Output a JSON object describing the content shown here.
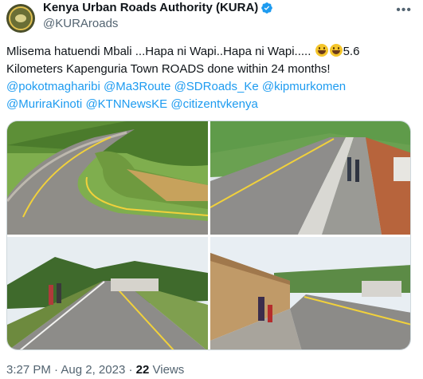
{
  "author": {
    "display_name": "Kenya Urban Roads Authority (KURA)",
    "handle": "@KURAroads",
    "avatar_icon": "kura-logo",
    "verified_icon": "verified-badge-icon"
  },
  "tweet": {
    "text_part1": "Mlisema hatuendi Mbali ...Hapa ni Wapi..Hapa ni Wapi..... ",
    "emojis": [
      "grinning-face-emoji",
      "grinning-face-emoji"
    ],
    "text_part2": "5.6 Kilometers Kapenguria Town ROADS done within 24 months!",
    "mentions": [
      "@pokotmagharibi",
      "@Ma3Route",
      "@SDRoads_Ke",
      "@kipmurkomen",
      "@MuriraKinoti",
      "@KTNNewsKE",
      "@citizentvkenya"
    ]
  },
  "media": {
    "photos": [
      {
        "label": "photo-1",
        "alt": "curving paved road with yellow centerline"
      },
      {
        "label": "photo-2",
        "alt": "road with sidewalk and pedestrians"
      },
      {
        "label": "photo-3",
        "alt": "straight road with pedestrians"
      },
      {
        "label": "photo-4",
        "alt": "road beside stone wall with pedestrians"
      }
    ]
  },
  "meta": {
    "time": "3:27 PM",
    "separator": "·",
    "date": "Aug 2, 2023",
    "views_count": "22",
    "views_label": "Views"
  },
  "colors": {
    "link": "#1d9bf0",
    "secondary_text": "#536471",
    "primary_text": "#0f1419",
    "verified": "#1d9bf0"
  }
}
